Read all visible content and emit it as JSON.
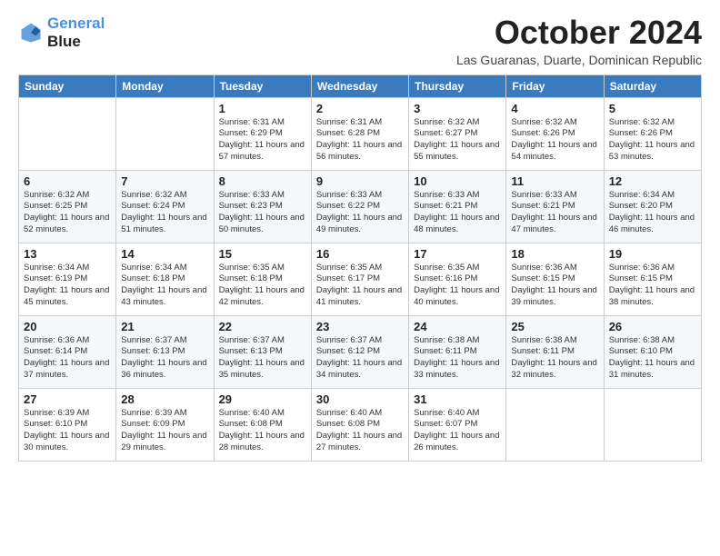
{
  "logo": {
    "line1": "General",
    "line2": "Blue"
  },
  "header": {
    "title": "October 2024",
    "subtitle": "Las Guaranas, Duarte, Dominican Republic"
  },
  "weekdays": [
    "Sunday",
    "Monday",
    "Tuesday",
    "Wednesday",
    "Thursday",
    "Friday",
    "Saturday"
  ],
  "weeks": [
    [
      {
        "day": "",
        "sunrise": "",
        "sunset": "",
        "daylight": ""
      },
      {
        "day": "",
        "sunrise": "",
        "sunset": "",
        "daylight": ""
      },
      {
        "day": "1",
        "sunrise": "Sunrise: 6:31 AM",
        "sunset": "Sunset: 6:29 PM",
        "daylight": "Daylight: 11 hours and 57 minutes."
      },
      {
        "day": "2",
        "sunrise": "Sunrise: 6:31 AM",
        "sunset": "Sunset: 6:28 PM",
        "daylight": "Daylight: 11 hours and 56 minutes."
      },
      {
        "day": "3",
        "sunrise": "Sunrise: 6:32 AM",
        "sunset": "Sunset: 6:27 PM",
        "daylight": "Daylight: 11 hours and 55 minutes."
      },
      {
        "day": "4",
        "sunrise": "Sunrise: 6:32 AM",
        "sunset": "Sunset: 6:26 PM",
        "daylight": "Daylight: 11 hours and 54 minutes."
      },
      {
        "day": "5",
        "sunrise": "Sunrise: 6:32 AM",
        "sunset": "Sunset: 6:26 PM",
        "daylight": "Daylight: 11 hours and 53 minutes."
      }
    ],
    [
      {
        "day": "6",
        "sunrise": "Sunrise: 6:32 AM",
        "sunset": "Sunset: 6:25 PM",
        "daylight": "Daylight: 11 hours and 52 minutes."
      },
      {
        "day": "7",
        "sunrise": "Sunrise: 6:32 AM",
        "sunset": "Sunset: 6:24 PM",
        "daylight": "Daylight: 11 hours and 51 minutes."
      },
      {
        "day": "8",
        "sunrise": "Sunrise: 6:33 AM",
        "sunset": "Sunset: 6:23 PM",
        "daylight": "Daylight: 11 hours and 50 minutes."
      },
      {
        "day": "9",
        "sunrise": "Sunrise: 6:33 AM",
        "sunset": "Sunset: 6:22 PM",
        "daylight": "Daylight: 11 hours and 49 minutes."
      },
      {
        "day": "10",
        "sunrise": "Sunrise: 6:33 AM",
        "sunset": "Sunset: 6:21 PM",
        "daylight": "Daylight: 11 hours and 48 minutes."
      },
      {
        "day": "11",
        "sunrise": "Sunrise: 6:33 AM",
        "sunset": "Sunset: 6:21 PM",
        "daylight": "Daylight: 11 hours and 47 minutes."
      },
      {
        "day": "12",
        "sunrise": "Sunrise: 6:34 AM",
        "sunset": "Sunset: 6:20 PM",
        "daylight": "Daylight: 11 hours and 46 minutes."
      }
    ],
    [
      {
        "day": "13",
        "sunrise": "Sunrise: 6:34 AM",
        "sunset": "Sunset: 6:19 PM",
        "daylight": "Daylight: 11 hours and 45 minutes."
      },
      {
        "day": "14",
        "sunrise": "Sunrise: 6:34 AM",
        "sunset": "Sunset: 6:18 PM",
        "daylight": "Daylight: 11 hours and 43 minutes."
      },
      {
        "day": "15",
        "sunrise": "Sunrise: 6:35 AM",
        "sunset": "Sunset: 6:18 PM",
        "daylight": "Daylight: 11 hours and 42 minutes."
      },
      {
        "day": "16",
        "sunrise": "Sunrise: 6:35 AM",
        "sunset": "Sunset: 6:17 PM",
        "daylight": "Daylight: 11 hours and 41 minutes."
      },
      {
        "day": "17",
        "sunrise": "Sunrise: 6:35 AM",
        "sunset": "Sunset: 6:16 PM",
        "daylight": "Daylight: 11 hours and 40 minutes."
      },
      {
        "day": "18",
        "sunrise": "Sunrise: 6:36 AM",
        "sunset": "Sunset: 6:15 PM",
        "daylight": "Daylight: 11 hours and 39 minutes."
      },
      {
        "day": "19",
        "sunrise": "Sunrise: 6:36 AM",
        "sunset": "Sunset: 6:15 PM",
        "daylight": "Daylight: 11 hours and 38 minutes."
      }
    ],
    [
      {
        "day": "20",
        "sunrise": "Sunrise: 6:36 AM",
        "sunset": "Sunset: 6:14 PM",
        "daylight": "Daylight: 11 hours and 37 minutes."
      },
      {
        "day": "21",
        "sunrise": "Sunrise: 6:37 AM",
        "sunset": "Sunset: 6:13 PM",
        "daylight": "Daylight: 11 hours and 36 minutes."
      },
      {
        "day": "22",
        "sunrise": "Sunrise: 6:37 AM",
        "sunset": "Sunset: 6:13 PM",
        "daylight": "Daylight: 11 hours and 35 minutes."
      },
      {
        "day": "23",
        "sunrise": "Sunrise: 6:37 AM",
        "sunset": "Sunset: 6:12 PM",
        "daylight": "Daylight: 11 hours and 34 minutes."
      },
      {
        "day": "24",
        "sunrise": "Sunrise: 6:38 AM",
        "sunset": "Sunset: 6:11 PM",
        "daylight": "Daylight: 11 hours and 33 minutes."
      },
      {
        "day": "25",
        "sunrise": "Sunrise: 6:38 AM",
        "sunset": "Sunset: 6:11 PM",
        "daylight": "Daylight: 11 hours and 32 minutes."
      },
      {
        "day": "26",
        "sunrise": "Sunrise: 6:38 AM",
        "sunset": "Sunset: 6:10 PM",
        "daylight": "Daylight: 11 hours and 31 minutes."
      }
    ],
    [
      {
        "day": "27",
        "sunrise": "Sunrise: 6:39 AM",
        "sunset": "Sunset: 6:10 PM",
        "daylight": "Daylight: 11 hours and 30 minutes."
      },
      {
        "day": "28",
        "sunrise": "Sunrise: 6:39 AM",
        "sunset": "Sunset: 6:09 PM",
        "daylight": "Daylight: 11 hours and 29 minutes."
      },
      {
        "day": "29",
        "sunrise": "Sunrise: 6:40 AM",
        "sunset": "Sunset: 6:08 PM",
        "daylight": "Daylight: 11 hours and 28 minutes."
      },
      {
        "day": "30",
        "sunrise": "Sunrise: 6:40 AM",
        "sunset": "Sunset: 6:08 PM",
        "daylight": "Daylight: 11 hours and 27 minutes."
      },
      {
        "day": "31",
        "sunrise": "Sunrise: 6:40 AM",
        "sunset": "Sunset: 6:07 PM",
        "daylight": "Daylight: 11 hours and 26 minutes."
      },
      {
        "day": "",
        "sunrise": "",
        "sunset": "",
        "daylight": ""
      },
      {
        "day": "",
        "sunrise": "",
        "sunset": "",
        "daylight": ""
      }
    ]
  ]
}
